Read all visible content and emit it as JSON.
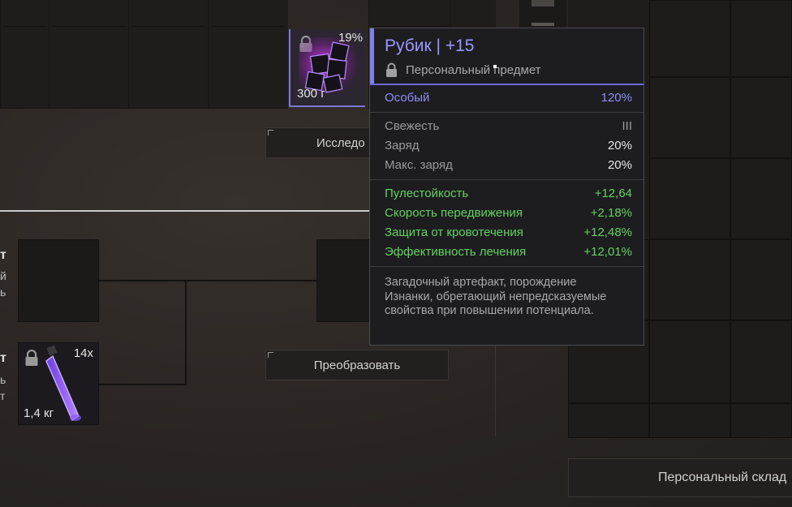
{
  "tooltip": {
    "title": "Рубик | +15",
    "subtitle": "Персональный предмет",
    "rarity_label": "Особый",
    "rarity_value": "120%",
    "props": [
      {
        "label": "Свежесть",
        "value": "III"
      },
      {
        "label": "Заряд",
        "value": "20%"
      },
      {
        "label": "Макс. заряд",
        "value": "20%"
      }
    ],
    "stats": [
      {
        "label": "Пулестойкость",
        "value": "+12,64"
      },
      {
        "label": "Скорость передвижения",
        "value": "+2,18%"
      },
      {
        "label": "Защита от кровотечения",
        "value": "+12,48%"
      },
      {
        "label": "Эффективность лечения",
        "value": "+12,01%"
      }
    ],
    "description": "Загадочный артефакт, порождение Изнанки, обретающий непредсказуемые свойства при повышении потенциала.",
    "colors": {
      "title": "#9c98ff",
      "stat": "#64d260",
      "accent": "#7f7fe8"
    }
  },
  "artifact_slot": {
    "percent": "19%",
    "weight": "300 г",
    "icon": "cube-artifact-icon"
  },
  "consumable_slot": {
    "count": "14x",
    "weight": "1,4 кг",
    "icon": "purple-tube-icon"
  },
  "buttons": {
    "research": "Исследо",
    "transform": "Преобразовать",
    "personal_storage": "Персональный склад"
  },
  "edge_labels": {
    "a1": "т",
    "a2": "й",
    "a3": "ь",
    "b1": "т",
    "b2": "ь",
    "b3": "т"
  }
}
